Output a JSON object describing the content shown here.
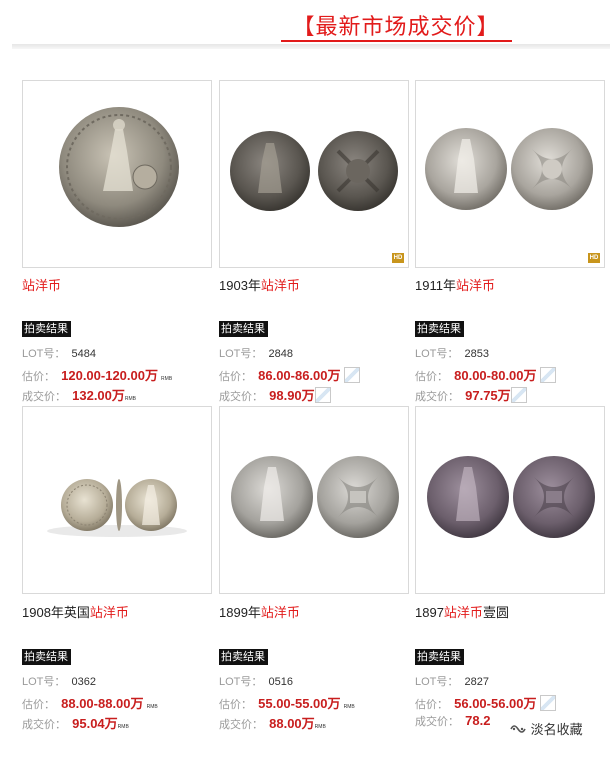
{
  "header": {
    "title": "【最新市场成交价】"
  },
  "labels": {
    "badge": "拍卖结果",
    "lot": "LOT号：",
    "estimate": "估价：",
    "sold": "成交价：",
    "rmb": "RMB",
    "hd": "HD"
  },
  "cards": [
    {
      "title_pre": "",
      "title_red": "站洋币",
      "title_post": "",
      "lot": "5484",
      "estimate": "120.00-120.00万",
      "sold": "132.00万",
      "hd": false
    },
    {
      "title_pre": "1903年",
      "title_red": "站洋币",
      "title_post": "",
      "lot": "2848",
      "estimate": "86.00-86.00万",
      "sold": "98.90万",
      "hd": true
    },
    {
      "title_pre": "1911年",
      "title_red": "站洋币",
      "title_post": "",
      "lot": "2853",
      "estimate": "80.00-80.00万",
      "sold": "97.75万",
      "hd": true
    },
    {
      "title_pre": "1908年英国",
      "title_red": "站洋币",
      "title_post": "",
      "lot": "0362",
      "estimate": "88.00-88.00万",
      "sold": "95.04万",
      "hd": false
    },
    {
      "title_pre": "1899年",
      "title_red": "站洋币",
      "title_post": "",
      "lot": "0516",
      "estimate": "55.00-55.00万",
      "sold": "88.00万",
      "hd": false
    },
    {
      "title_pre": "1897",
      "title_red": "站洋币",
      "title_post": "壹圆",
      "lot": "2827",
      "estimate": "56.00-56.00万",
      "sold": "78.2",
      "hd": false
    }
  ],
  "watermark": {
    "text": "淡名收藏",
    "icon": "wechat-channel-icon"
  }
}
